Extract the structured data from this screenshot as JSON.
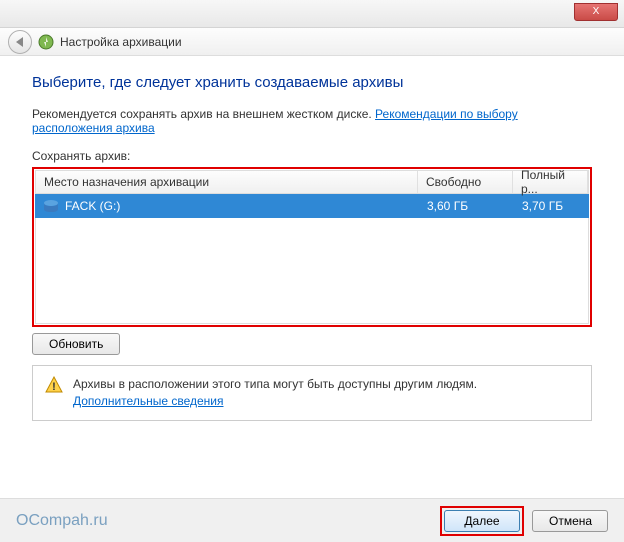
{
  "titlebar": {
    "close": "X"
  },
  "header": {
    "title": "Настройка архивации"
  },
  "content": {
    "heading": "Выберите, где следует хранить создаваемые архивы",
    "recommendation": "Рекомендуется сохранять архив на внешнем жестком диске. ",
    "recommendation_link": "Рекомендации по выбору расположения архива",
    "save_label": "Сохранять архив:",
    "columns": {
      "c1": "Место назначения архивации",
      "c2": "Свободно",
      "c3": "Полный р..."
    },
    "rows": [
      {
        "name": "FACK (G:)",
        "free": "3,60 ГБ",
        "total": "3,70 ГБ"
      }
    ],
    "refresh": "Обновить",
    "warning": "Архивы в расположении этого типа могут быть доступны другим людям.",
    "warning_link": "Дополнительные сведения"
  },
  "footer": {
    "watermark": "OCompah.ru",
    "next": "Далее",
    "cancel": "Отмена"
  }
}
